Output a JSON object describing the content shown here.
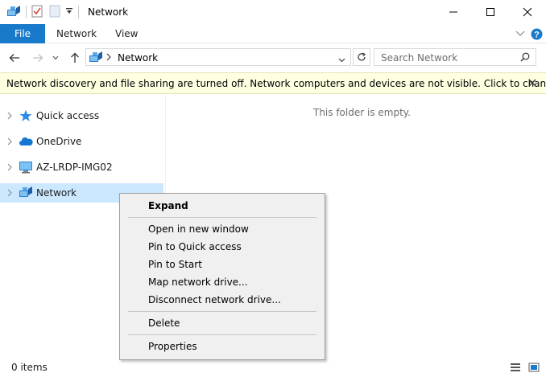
{
  "window": {
    "title": "Network"
  },
  "ribbon": {
    "tabs": [
      "File",
      "Network",
      "View"
    ],
    "expand_icon": "chevron-down-icon",
    "help_icon": "help-icon"
  },
  "address": {
    "path": "Network",
    "search_placeholder": "Search Network"
  },
  "infobar": {
    "message": "Network discovery and file sharing are turned off. Network computers and devices are not visible. Click to change..."
  },
  "nav": {
    "items": [
      {
        "label": "Quick access",
        "icon": "star-icon"
      },
      {
        "label": "OneDrive",
        "icon": "cloud-icon"
      },
      {
        "label": "AZ-LRDP-IMG02",
        "icon": "computer-icon"
      },
      {
        "label": "Network",
        "icon": "network-icon",
        "selected": true
      }
    ]
  },
  "main": {
    "empty_message": "This folder is empty."
  },
  "context_menu": {
    "items": [
      "Expand",
      "Open in new window",
      "Pin to Quick access",
      "Pin to Start",
      "Map network drive...",
      "Disconnect network drive...",
      "Delete",
      "Properties"
    ]
  },
  "status": {
    "items_count": "0 items"
  },
  "colors": {
    "file_tab": "#1979ca",
    "infobar_bg": "#ffffe1",
    "selection": "#cce8ff",
    "menu_bg": "#f0f0f0"
  }
}
